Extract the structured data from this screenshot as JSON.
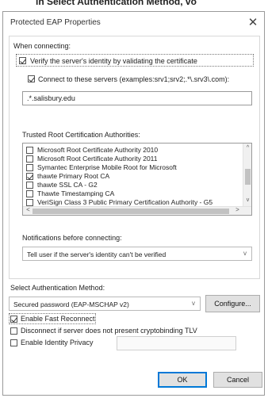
{
  "caption": {
    "prefix": "in ",
    "bold": "Select Authentication Method",
    "suffix": ", vo"
  },
  "window": {
    "title": "Protected EAP Properties",
    "close_glyph": "✕"
  },
  "connecting": {
    "heading": "When connecting:",
    "verify_label": "Verify the server's identity by validating the certificate",
    "verify_checked": true,
    "connect_label": "Connect to these servers (examples:srv1;srv2;.*\\.srv3\\.com):",
    "connect_checked": true,
    "servers_value": ".*.salisbury.edu"
  },
  "trusted_roots": {
    "heading": "Trusted Root Certification Authorities:",
    "items": [
      {
        "label": "Microsoft Root Certificate Authority 2010",
        "checked": false
      },
      {
        "label": "Microsoft Root Certificate Authority 2011",
        "checked": false
      },
      {
        "label": "Symantec Enterprise Mobile Root for Microsoft",
        "checked": false
      },
      {
        "label": "thawte Primary Root CA",
        "checked": true
      },
      {
        "label": "thawte SSL CA - G2",
        "checked": false
      },
      {
        "label": "Thawte Timestamping CA",
        "checked": false
      },
      {
        "label": "VeriSign Class 3 Public Primary Certification Authority - G5",
        "checked": false
      }
    ],
    "scroll_up": "^",
    "scroll_down": "v",
    "scroll_left": "<",
    "scroll_right": ">"
  },
  "notifications": {
    "heading": "Notifications before connecting:",
    "selected": "Tell user if the server's identity can't be verified",
    "chevron": "v"
  },
  "auth": {
    "heading": "Select Authentication Method:",
    "selected": "Secured password (EAP-MSCHAP v2)",
    "chevron": "v",
    "configure_label": "Configure..."
  },
  "options": [
    {
      "label": "Enable Fast Reconnect",
      "checked": true
    },
    {
      "label": "Disconnect if server does not present cryptobinding TLV",
      "checked": false
    },
    {
      "label": "Enable Identity Privacy",
      "checked": false
    }
  ],
  "identity_privacy_value": "",
  "buttons": {
    "ok": "OK",
    "cancel": "Cancel"
  }
}
